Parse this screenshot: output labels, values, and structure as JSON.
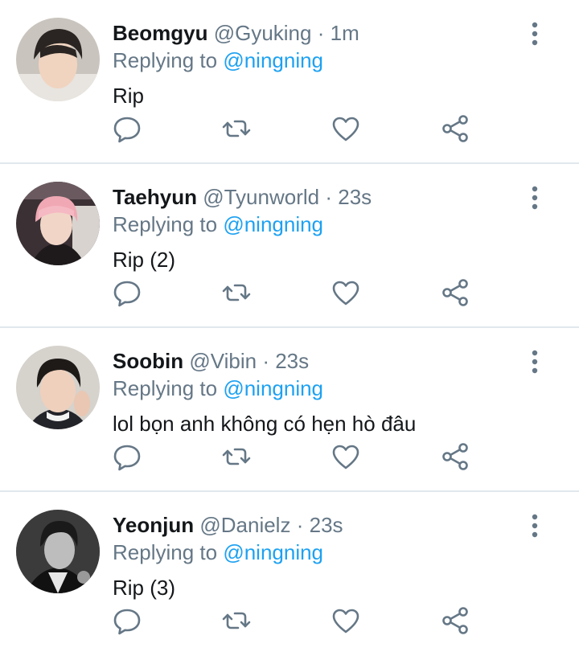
{
  "replying_prefix": "Replying to",
  "tweets": [
    {
      "name": "Beomgyu",
      "handle": "@Gyuking",
      "dot": "·",
      "time": "1m",
      "replying_to": "@ningning",
      "text": "Rip"
    },
    {
      "name": "Taehyun",
      "handle": "@Tyunworld",
      "dot": "·",
      "time": "23s",
      "replying_to": "@ningning",
      "text": "Rip (2)"
    },
    {
      "name": "Soobin",
      "handle": "@Vibin",
      "dot": "·",
      "time": "23s",
      "replying_to": "@ningning",
      "text": "lol bọn anh không có hẹn hò đâu"
    },
    {
      "name": "Yeonjun",
      "handle": "@Danielz",
      "dot": "·",
      "time": "23s",
      "replying_to": "@ningning",
      "text": "Rip (3)"
    }
  ],
  "colors": {
    "text": "#14171a",
    "secondary": "#657786",
    "link": "#1da1f2",
    "icon": "#657786",
    "divider": "#e1e8ed"
  },
  "icons": {
    "reply": "reply-icon",
    "retweet": "retweet-icon",
    "like": "like-icon",
    "share": "share-icon",
    "more": "more-vertical-icon"
  }
}
